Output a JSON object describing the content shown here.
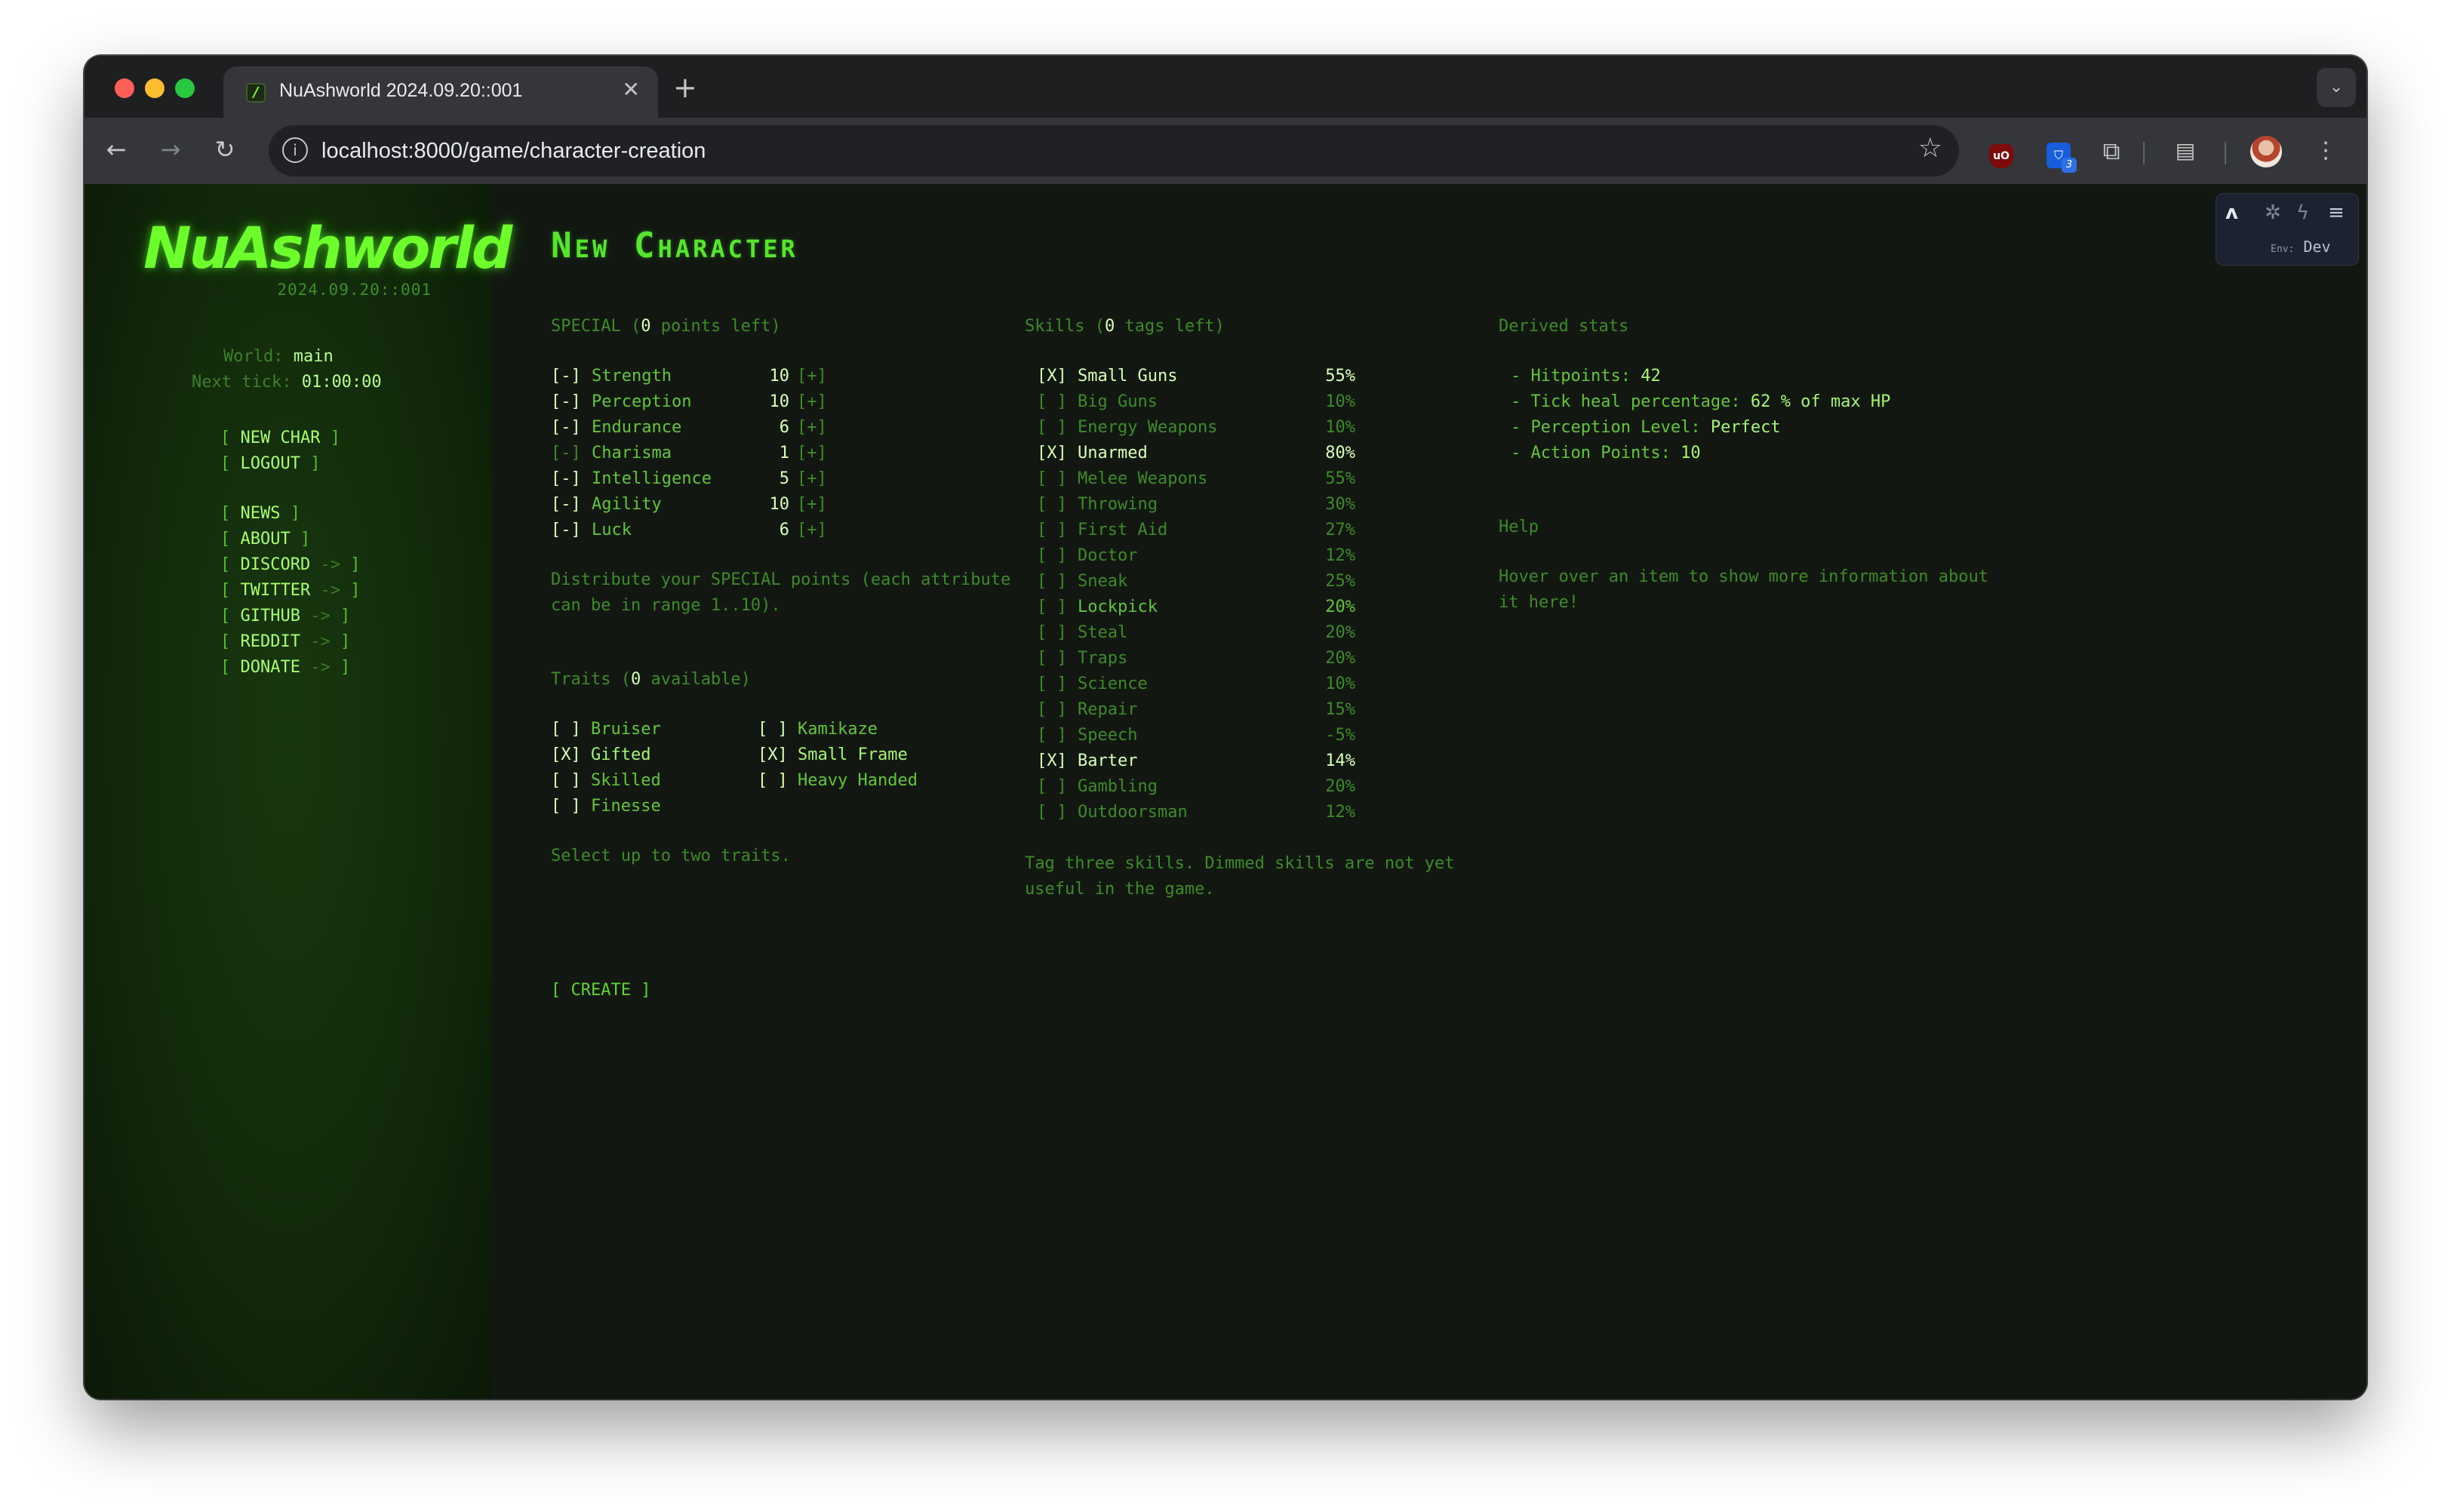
{
  "browser": {
    "tab_title": "NuAshworld 2024.09.20::001",
    "tab_close": "✕",
    "new_tab": "+",
    "url": "localhost:8000/game/character-creation",
    "ublock_label": "uO",
    "bitwarden_badge": "3"
  },
  "sidebar": {
    "logo": "NuAshworld",
    "version": "2024.09.20::001",
    "world_label": "World:",
    "world_value": "main",
    "tick_label": "Next tick:",
    "tick_value": "01:00:00",
    "links": [
      {
        "label": "NEW CHAR",
        "external": false
      },
      {
        "label": "LOGOUT",
        "external": false
      },
      {
        "label": "NEWS",
        "external": false
      },
      {
        "label": "ABOUT",
        "external": false
      },
      {
        "label": "DISCORD",
        "external": true
      },
      {
        "label": "TWITTER",
        "external": true
      },
      {
        "label": "GITHUB",
        "external": true
      },
      {
        "label": "REDDIT",
        "external": true
      },
      {
        "label": "DONATE",
        "external": true
      }
    ]
  },
  "main": {
    "title": "New Character",
    "special": {
      "heading_prefix": "SPECIAL (",
      "points_left": "0",
      "heading_suffix": " points left)",
      "minus": "[-]",
      "plus": "[+]",
      "stats": [
        {
          "name": "Strength",
          "value": "10"
        },
        {
          "name": "Perception",
          "value": "10"
        },
        {
          "name": "Endurance",
          "value": "6"
        },
        {
          "name": "Charisma",
          "value": "1"
        },
        {
          "name": "Intelligence",
          "value": "5"
        },
        {
          "name": "Agility",
          "value": "10"
        },
        {
          "name": "Luck",
          "value": "6"
        }
      ],
      "help_line1": "Distribute your SPECIAL points (each attribute",
      "help_line2": "can be in range 1..10)."
    },
    "traits": {
      "heading_prefix": "Traits (",
      "available": "0",
      "heading_suffix": " available)",
      "items": [
        {
          "mark": "[ ]",
          "name": "Bruiser"
        },
        {
          "mark": "[X]",
          "name": "Gifted"
        },
        {
          "mark": "[ ]",
          "name": "Skilled"
        },
        {
          "mark": "[ ]",
          "name": "Finesse"
        },
        {
          "mark": "[ ]",
          "name": "Kamikaze"
        },
        {
          "mark": "[X]",
          "name": "Small Frame"
        },
        {
          "mark": "[ ]",
          "name": "Heavy Handed"
        }
      ],
      "help": "Select up to two traits."
    },
    "skills": {
      "heading_prefix": "Skills (",
      "tags_left": "0",
      "heading_suffix": " tags left)",
      "items": [
        {
          "mark": "[X]",
          "name": "Small Guns",
          "value": "55%"
        },
        {
          "mark": "[ ]",
          "name": "Big Guns",
          "value": "10%"
        },
        {
          "mark": "[ ]",
          "name": "Energy Weapons",
          "value": "10%"
        },
        {
          "mark": "[X]",
          "name": "Unarmed",
          "value": "80%"
        },
        {
          "mark": "[ ]",
          "name": "Melee Weapons",
          "value": "55%"
        },
        {
          "mark": "[ ]",
          "name": "Throwing",
          "value": "30%"
        },
        {
          "mark": "[ ]",
          "name": "First Aid",
          "value": "27%"
        },
        {
          "mark": "[ ]",
          "name": "Doctor",
          "value": "12%"
        },
        {
          "mark": "[ ]",
          "name": "Sneak",
          "value": "25%"
        },
        {
          "mark": "[ ]",
          "name": "Lockpick",
          "value": "20%"
        },
        {
          "mark": "[ ]",
          "name": "Steal",
          "value": "20%"
        },
        {
          "mark": "[ ]",
          "name": "Traps",
          "value": "20%"
        },
        {
          "mark": "[ ]",
          "name": "Science",
          "value": "10%"
        },
        {
          "mark": "[ ]",
          "name": "Repair",
          "value": "15%"
        },
        {
          "mark": "[ ]",
          "name": "Speech",
          "value": "-5%"
        },
        {
          "mark": "[X]",
          "name": "Barter",
          "value": "14%"
        },
        {
          "mark": "[ ]",
          "name": "Gambling",
          "value": "20%"
        },
        {
          "mark": "[ ]",
          "name": "Outdoorsman",
          "value": "12%"
        }
      ],
      "help_line1": "Tag three skills. Dimmed skills are not yet",
      "help_line2": "useful in the game."
    },
    "derived": {
      "heading": "Derived stats",
      "hp_label": "- Hitpoints:",
      "hp_value": "42",
      "tick_label": "- Tick heal percentage:",
      "tick_value": "62 % of max HP",
      "perc_label": "- Perception Level:",
      "perc_value": "Perfect",
      "ap_label": "- Action Points:",
      "ap_value": "10"
    },
    "help": {
      "heading": "Help",
      "line1": "Hover over an item to show more information about",
      "line2": "it here!"
    },
    "create_button": "[ CREATE ]"
  },
  "dev_widget": {
    "env_label": "Env:",
    "env_value": "Dev"
  }
}
